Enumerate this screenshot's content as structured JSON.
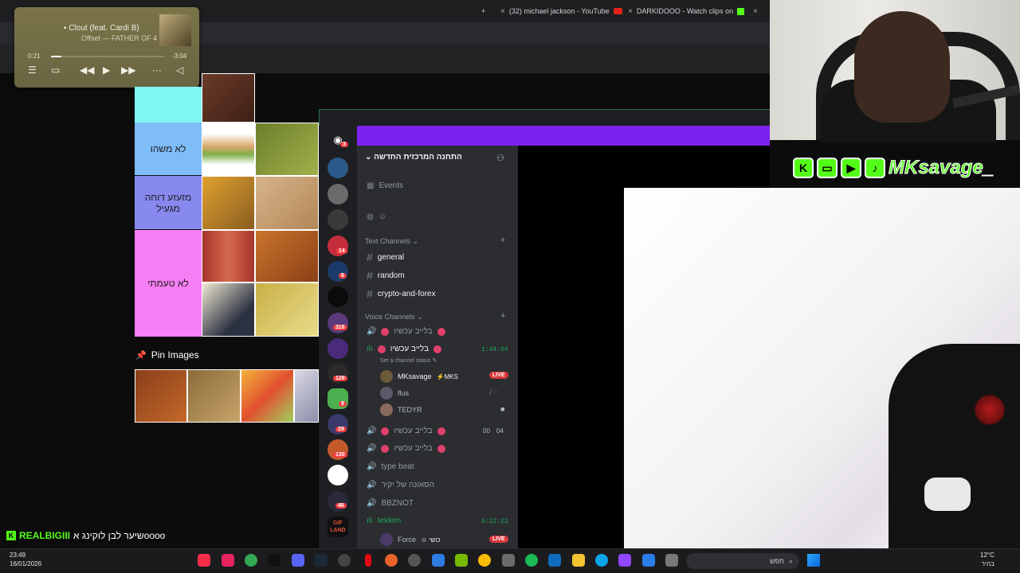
{
  "browser": {
    "tabs": [
      {
        "label": "(32) michael jackson - YouTube"
      },
      {
        "label": "DARKIDOOO - Watch clips on"
      }
    ],
    "new_tab": "+",
    "close": "×"
  },
  "music": {
    "title": "Clout (feat. Cardi B)",
    "artist": "Offset — FATHER OF 4",
    "elapsed": "0:21",
    "remaining": "-3:04",
    "progress": 0.09
  },
  "tier_list": {
    "rows": [
      {
        "label": "",
        "color": "#7ff7f2"
      },
      {
        "label": "לא משהו",
        "color": "#7ebdf8"
      },
      {
        "label": "מזעזע דוחה מגעיל",
        "color": "#8789ef"
      },
      {
        "label": "לא טעמתי",
        "color": "#f77ef4"
      }
    ],
    "pin_images_label": "Pin Images"
  },
  "discord": {
    "server_name": "התחנה המרכזית החדשה",
    "events_label": "Events",
    "text_category": "Text Channels",
    "text_channels": [
      "general",
      "random",
      "crypto-and-forex"
    ],
    "voice_category": "Voice Channels",
    "voice_channels": [
      {
        "name": "בלייב עכשיו"
      },
      {
        "name": "בלייב עכשיו",
        "status": "Set a channel status",
        "timer": "1:44:04"
      },
      {
        "name": "בלייב עכשיו",
        "counts": [
          "00",
          "04"
        ]
      },
      {
        "name": "בלייב עכשיו"
      },
      {
        "name": "type beat"
      },
      {
        "name": "הסאונה של יקיר"
      },
      {
        "name": "BBZNOT"
      },
      {
        "name": "tekken",
        "timer": "6:22:23"
      }
    ],
    "voice_users": [
      {
        "name": "MKsavage",
        "tag": "MKS",
        "live": "LIVE"
      },
      {
        "name": "flus"
      },
      {
        "name": "TEDYR"
      }
    ],
    "tekken_user": {
      "name": "Force",
      "tag": "כושי",
      "live": "LIVE"
    },
    "server_badges": [
      "3",
      "14",
      "6",
      "316",
      "129",
      "9",
      "29",
      "130",
      "46"
    ],
    "server_logo_text": "GIF LAND"
  },
  "overlay": {
    "name": "MKsavage_",
    "icons": [
      "K",
      "twitch",
      "youtube",
      "tiktok"
    ]
  },
  "chat": {
    "user": "REALBIGIII",
    "message": "שיער לבן לוקינג אoooo"
  },
  "taskbar": {
    "time": "23:49",
    "date": "16/01/2026",
    "search_placeholder": "חפש",
    "temperature": "12°C",
    "weather": "בהיר"
  },
  "colors": {
    "discord_purple": "#7b22f0",
    "kick_green": "#53fc18",
    "live_red": "#da373c"
  }
}
